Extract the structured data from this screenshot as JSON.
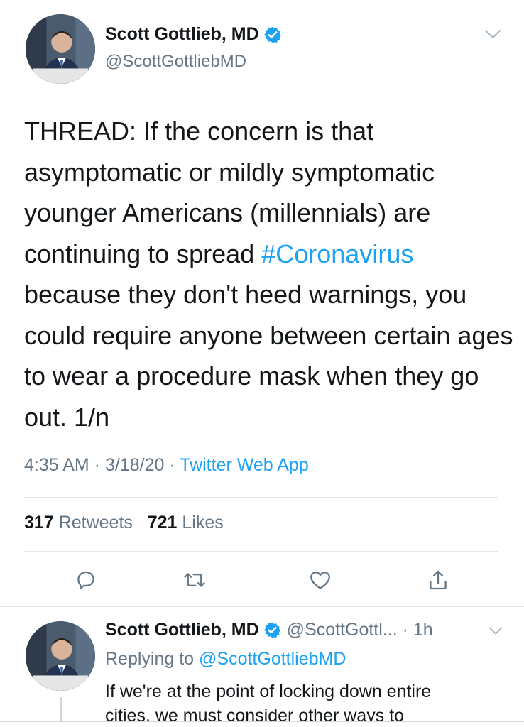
{
  "main_tweet": {
    "display_name": "Scott Gottlieb, MD",
    "handle": "@ScottGottliebMD",
    "text_before": "THREAD: If the concern is that asymptomatic or mildly symptomatic younger Americans (millennials) are continuing to spread ",
    "hashtag": "#Coronavirus",
    "text_after": " because they don't heed warnings, you could require anyone between certain ages to wear a procedure mask when they go out. 1/n",
    "time": "4:35 AM",
    "date": "3/18/20",
    "source": "Twitter Web App",
    "retweets_count": "317",
    "retweets_label": "Retweets",
    "likes_count": "721",
    "likes_label": "Likes"
  },
  "reply_tweet": {
    "display_name": "Scott Gottlieb, MD",
    "handle": "@ScottGottl...",
    "age": "1h",
    "replying_prefix": "Replying to",
    "replying_to": "@ScottGottliebMD",
    "line1": "If we're at the point of locking down entire",
    "line2": "cities, we must consider other ways to"
  },
  "colors": {
    "link": "#1da1f2",
    "secondary_text": "#657786",
    "divider": "#e1e8ed"
  },
  "icons": [
    "verified-icon",
    "chevron-down-icon",
    "reply-icon",
    "retweet-icon",
    "like-icon",
    "share-icon"
  ]
}
